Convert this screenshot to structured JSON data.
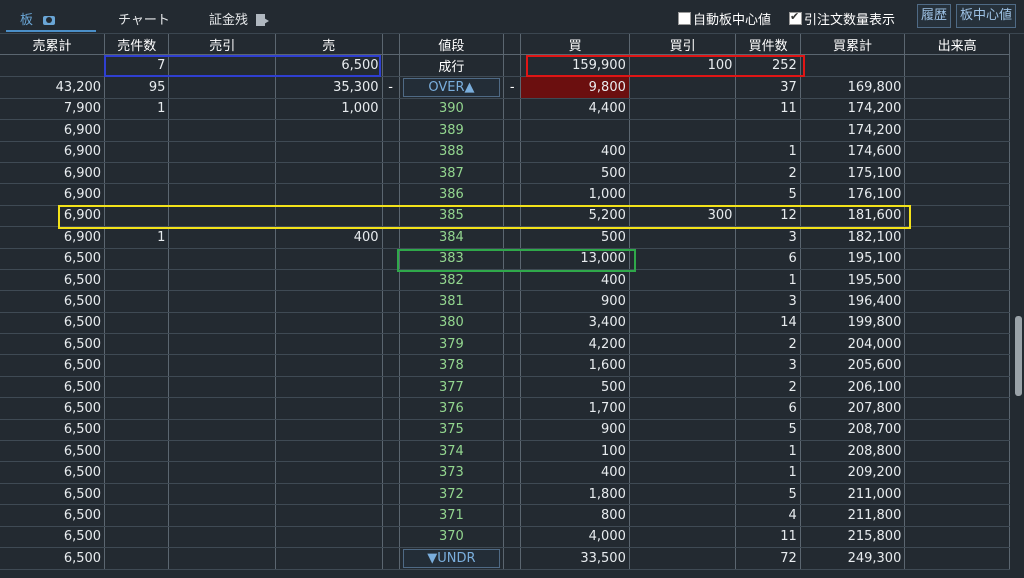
{
  "tabs": [
    {
      "label": "板"
    },
    {
      "label": "チャート"
    },
    {
      "label": "証金残"
    }
  ],
  "options": {
    "auto_center": {
      "label": "自動板中心値",
      "checked": false
    },
    "show_hikichu": {
      "label": "引注文数量表示",
      "checked": true
    }
  },
  "buttons": {
    "history": "履歴",
    "center": "板中心値"
  },
  "columns": [
    "売累計",
    "売件数",
    "売引",
    "売",
    "",
    "値段",
    "",
    "買",
    "買引",
    "買件数",
    "買累計",
    "出来高"
  ],
  "market_row": {
    "sell_count": "7",
    "sell_qty": "6,500",
    "price": "成行",
    "buy_qty": "159,900",
    "buy_hiki": "100",
    "buy_count": "252"
  },
  "over_row": {
    "sell_cum": "43,200",
    "sell_count": "95",
    "sell_qty": "35,300",
    "left_dash": "-",
    "label": "OVER▲",
    "right_dash": "-",
    "buy_qty": "9,800",
    "buy_count": "37",
    "buy_cum": "169,800"
  },
  "rows": [
    {
      "sell_cum": "7,900",
      "sell_count": "1",
      "sell_qty": "1,000",
      "price": "390",
      "buy_qty": "4,400",
      "buy_hiki": "",
      "buy_count": "11",
      "buy_cum": "174,200"
    },
    {
      "sell_cum": "6,900",
      "sell_count": "",
      "sell_qty": "",
      "price": "389",
      "buy_qty": "",
      "buy_hiki": "",
      "buy_count": "",
      "buy_cum": "174,200"
    },
    {
      "sell_cum": "6,900",
      "sell_count": "",
      "sell_qty": "",
      "price": "388",
      "buy_qty": "400",
      "buy_hiki": "",
      "buy_count": "1",
      "buy_cum": "174,600"
    },
    {
      "sell_cum": "6,900",
      "sell_count": "",
      "sell_qty": "",
      "price": "387",
      "buy_qty": "500",
      "buy_hiki": "",
      "buy_count": "2",
      "buy_cum": "175,100"
    },
    {
      "sell_cum": "6,900",
      "sell_count": "",
      "sell_qty": "",
      "price": "386",
      "buy_qty": "1,000",
      "buy_hiki": "",
      "buy_count": "5",
      "buy_cum": "176,100"
    },
    {
      "sell_cum": "6,900",
      "sell_count": "",
      "sell_qty": "",
      "price": "385",
      "buy_qty": "5,200",
      "buy_hiki": "300",
      "buy_count": "12",
      "buy_cum": "181,600"
    },
    {
      "sell_cum": "6,900",
      "sell_count": "1",
      "sell_qty": "400",
      "price": "384",
      "buy_qty": "500",
      "buy_hiki": "",
      "buy_count": "3",
      "buy_cum": "182,100"
    },
    {
      "sell_cum": "6,500",
      "sell_count": "",
      "sell_qty": "",
      "price": "383",
      "buy_qty": "13,000",
      "buy_hiki": "",
      "buy_count": "6",
      "buy_cum": "195,100"
    },
    {
      "sell_cum": "6,500",
      "sell_count": "",
      "sell_qty": "",
      "price": "382",
      "buy_qty": "400",
      "buy_hiki": "",
      "buy_count": "1",
      "buy_cum": "195,500"
    },
    {
      "sell_cum": "6,500",
      "sell_count": "",
      "sell_qty": "",
      "price": "381",
      "buy_qty": "900",
      "buy_hiki": "",
      "buy_count": "3",
      "buy_cum": "196,400"
    },
    {
      "sell_cum": "6,500",
      "sell_count": "",
      "sell_qty": "",
      "price": "380",
      "buy_qty": "3,400",
      "buy_hiki": "",
      "buy_count": "14",
      "buy_cum": "199,800"
    },
    {
      "sell_cum": "6,500",
      "sell_count": "",
      "sell_qty": "",
      "price": "379",
      "buy_qty": "4,200",
      "buy_hiki": "",
      "buy_count": "2",
      "buy_cum": "204,000"
    },
    {
      "sell_cum": "6,500",
      "sell_count": "",
      "sell_qty": "",
      "price": "378",
      "buy_qty": "1,600",
      "buy_hiki": "",
      "buy_count": "3",
      "buy_cum": "205,600"
    },
    {
      "sell_cum": "6,500",
      "sell_count": "",
      "sell_qty": "",
      "price": "377",
      "buy_qty": "500",
      "buy_hiki": "",
      "buy_count": "2",
      "buy_cum": "206,100"
    },
    {
      "sell_cum": "6,500",
      "sell_count": "",
      "sell_qty": "",
      "price": "376",
      "buy_qty": "1,700",
      "buy_hiki": "",
      "buy_count": "6",
      "buy_cum": "207,800"
    },
    {
      "sell_cum": "6,500",
      "sell_count": "",
      "sell_qty": "",
      "price": "375",
      "buy_qty": "900",
      "buy_hiki": "",
      "buy_count": "5",
      "buy_cum": "208,700"
    },
    {
      "sell_cum": "6,500",
      "sell_count": "",
      "sell_qty": "",
      "price": "374",
      "buy_qty": "100",
      "buy_hiki": "",
      "buy_count": "1",
      "buy_cum": "208,800"
    },
    {
      "sell_cum": "6,500",
      "sell_count": "",
      "sell_qty": "",
      "price": "373",
      "buy_qty": "400",
      "buy_hiki": "",
      "buy_count": "1",
      "buy_cum": "209,200"
    },
    {
      "sell_cum": "6,500",
      "sell_count": "",
      "sell_qty": "",
      "price": "372",
      "buy_qty": "1,800",
      "buy_hiki": "",
      "buy_count": "5",
      "buy_cum": "211,000"
    },
    {
      "sell_cum": "6,500",
      "sell_count": "",
      "sell_qty": "",
      "price": "371",
      "buy_qty": "800",
      "buy_hiki": "",
      "buy_count": "4",
      "buy_cum": "211,800"
    },
    {
      "sell_cum": "6,500",
      "sell_count": "",
      "sell_qty": "",
      "price": "370",
      "buy_qty": "4,000",
      "buy_hiki": "",
      "buy_count": "11",
      "buy_cum": "215,800"
    }
  ],
  "under_row": {
    "sell_cum": "6,500",
    "label": "▼UNDR",
    "buy_qty": "33,500",
    "buy_count": "72",
    "buy_cum": "249,300"
  },
  "colors": {
    "price_green": "#93d68f",
    "over_bg": "#6b0f0f",
    "box_blue": "#2f3fd0",
    "box_red": "#e01515",
    "box_yellow": "#f3e21a",
    "box_green": "#2fa84a"
  }
}
